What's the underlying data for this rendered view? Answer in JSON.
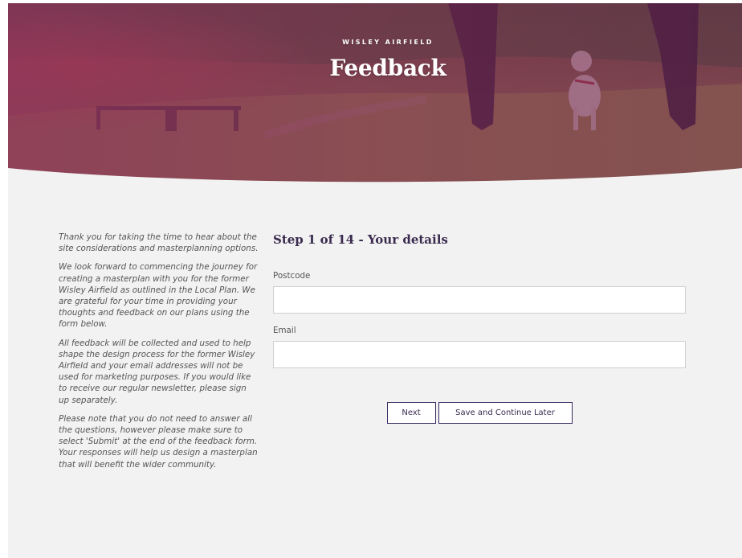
{
  "hero": {
    "eyebrow": "WISLEY AIRFIELD",
    "title": "Feedback"
  },
  "intro": {
    "paragraphs": [
      "Thank you for taking the time to hear about the site considerations and masterplanning options.",
      "We look forward to commencing the journey for creating a masterplan with you for the former Wisley Airfield as outlined in the Local Plan. We are grateful for your time in providing your thoughts and feedback on our plans using the form below.",
      "All feedback will be collected and used to help shape the design process for the former Wisley Airfield and your email addresses will not be used for marketing purposes. If you would like to receive our regular newsletter, please sign up separately.",
      "Please note that you do not need to answer all the questions, however please make sure to select 'Submit' at the end of the feedback form. Your responses will help us design a masterplan that will benefit the wider community."
    ]
  },
  "form": {
    "step_title": "Step 1 of 14 - Your details",
    "postcode": {
      "label": "Postcode",
      "value": "",
      "placeholder": ""
    },
    "email": {
      "label": "Email",
      "value": "",
      "placeholder": ""
    },
    "buttons": {
      "next": "Next",
      "save_later": "Save and Continue Later"
    }
  },
  "colors": {
    "hero_overlay": "#7a2a55",
    "page_background": "#f2f2f2",
    "heading": "#3a2b4f",
    "button_border": "#3a2b63",
    "body_text": "#555555"
  }
}
